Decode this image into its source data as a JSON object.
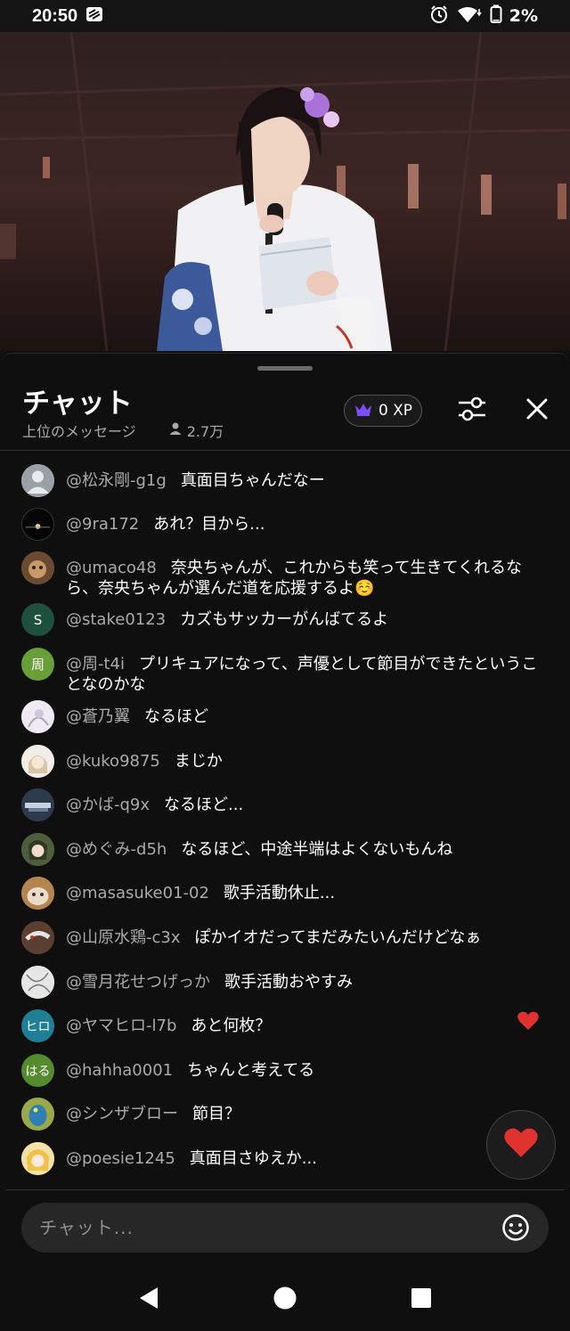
{
  "status_bar": {
    "time": "20:50",
    "battery": "2%",
    "icons": [
      "stacked-app-icon",
      "alarm-icon",
      "wifi-icon",
      "battery-icon"
    ]
  },
  "video": {
    "description_icon": "live-video-frame"
  },
  "chat_header": {
    "title": "チャット",
    "filter_label": "上位のメッセージ",
    "viewer_count": "2.7万",
    "xp_label": "0 XP"
  },
  "messages": [
    {
      "author": "@松永剛-g1g",
      "text": "真面目ちゃんだなー",
      "avatar_text": "",
      "avatar_color": "#9aa0a6",
      "avatar_kind": "default-user"
    },
    {
      "author": "@9ra172",
      "text": "あれ？目から...",
      "avatar_text": "",
      "avatar_color": "#0a0a0a",
      "avatar_kind": "photo"
    },
    {
      "author": "@umaco48",
      "text": "奈央ちゃんが、これからも笑って生きてくれるなら、奈央ちゃんが選んだ道を応援するよ☺️",
      "avatar_text": "",
      "avatar_color": "#7a5a3a",
      "avatar_kind": "photo"
    },
    {
      "author": "@stake0123",
      "text": "カズもサッカーがんばてるよ",
      "avatar_text": "S",
      "avatar_color": "#1f4f3d",
      "avatar_kind": "letter"
    },
    {
      "author": "@周-t4i",
      "text": "プリキュアになって、声優として節目ができたということなのかな",
      "avatar_text": "周",
      "avatar_color": "#689f38",
      "avatar_kind": "letter"
    },
    {
      "author": "@蒼乃翼",
      "text": "なるほど",
      "avatar_text": "",
      "avatar_color": "#e9e4ee",
      "avatar_kind": "photo"
    },
    {
      "author": "@kuko9875",
      "text": "まじか",
      "avatar_text": "",
      "avatar_color": "#efe9e2",
      "avatar_kind": "photo"
    },
    {
      "author": "@かば-q9x",
      "text": "なるほど...",
      "avatar_text": "",
      "avatar_color": "#3b4f66",
      "avatar_kind": "photo"
    },
    {
      "author": "@めぐみ-d5h",
      "text": "なるほど、中途半端はよくないもんね",
      "avatar_text": "",
      "avatar_color": "#4e5e3c",
      "avatar_kind": "photo"
    },
    {
      "author": "@masasuke01-02",
      "text": "歌手活動休止...",
      "avatar_text": "",
      "avatar_color": "#a0703f",
      "avatar_kind": "photo"
    },
    {
      "author": "@山原水鶏-c3x",
      "text": "ぽかイオだってまだみたいんだけどなぁ",
      "avatar_text": "",
      "avatar_color": "#6c4a3a",
      "avatar_kind": "photo"
    },
    {
      "author": "@雪月花せつげっか",
      "text": "歌手活動おやすみ",
      "avatar_text": "",
      "avatar_color": "#d8d8d8",
      "avatar_kind": "photo"
    },
    {
      "author": "@ヤマヒロ-l7b",
      "text": "あと何枚？",
      "avatar_text": "ヒロ",
      "avatar_color": "#1e7f95",
      "avatar_kind": "letter"
    },
    {
      "author": "@hahha0001",
      "text": "ちゃんと考えてる",
      "avatar_text": "はる",
      "avatar_color": "#558b2f",
      "avatar_kind": "letter"
    },
    {
      "author": "@シンザブロー",
      "text": "節目？",
      "avatar_text": "",
      "avatar_color": "#8a9a3a",
      "avatar_kind": "photo"
    },
    {
      "author": "@poesie1245",
      "text": "真面目さゆえか...",
      "avatar_text": "",
      "avatar_color": "#e6c36a",
      "avatar_kind": "photo"
    }
  ],
  "input": {
    "placeholder": "チャット..."
  },
  "colors": {
    "accent_heart": "#e0322f",
    "crown": "#7c4dff",
    "background": "#0f0f0f"
  }
}
